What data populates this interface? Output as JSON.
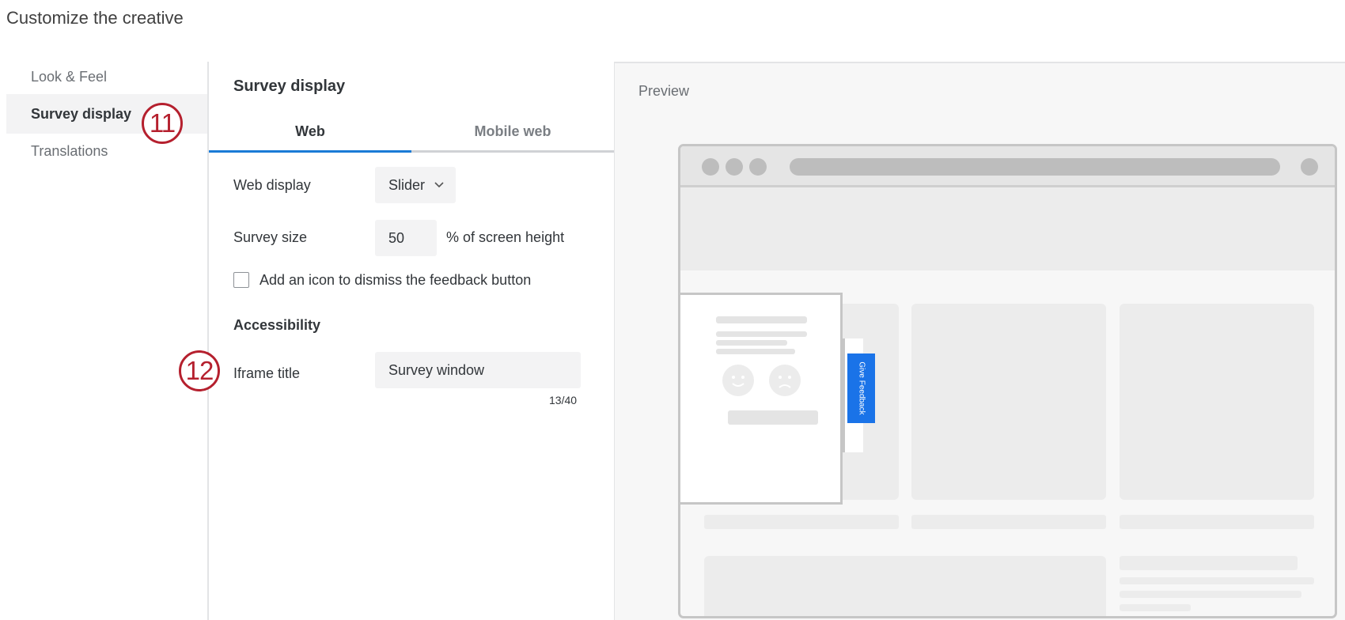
{
  "page": {
    "title": "Customize the creative"
  },
  "sidebar": {
    "items": [
      {
        "label": "Look & Feel"
      },
      {
        "label": "Survey display"
      },
      {
        "label": "Translations"
      }
    ]
  },
  "callouts": {
    "first": "11",
    "second": "12"
  },
  "panel": {
    "title": "Survey display",
    "tabs": [
      {
        "label": "Web"
      },
      {
        "label": "Mobile web"
      }
    ],
    "web_display": {
      "label": "Web display",
      "value": "Slider"
    },
    "survey_size": {
      "label": "Survey size",
      "value": "50",
      "suffix": "% of screen height"
    },
    "dismiss_icon": {
      "label": "Add an icon to dismiss the feedback button",
      "checked": false
    },
    "accessibility": {
      "heading": "Accessibility",
      "iframe_title": {
        "label": "Iframe title",
        "value": "Survey window",
        "counter": "13/40"
      }
    }
  },
  "preview": {
    "label": "Preview",
    "feedback_button": "Give Feedback"
  },
  "colors": {
    "accent": "#1a7bd6",
    "callout": "#b5202e",
    "feedback_button": "#1a73e8"
  }
}
